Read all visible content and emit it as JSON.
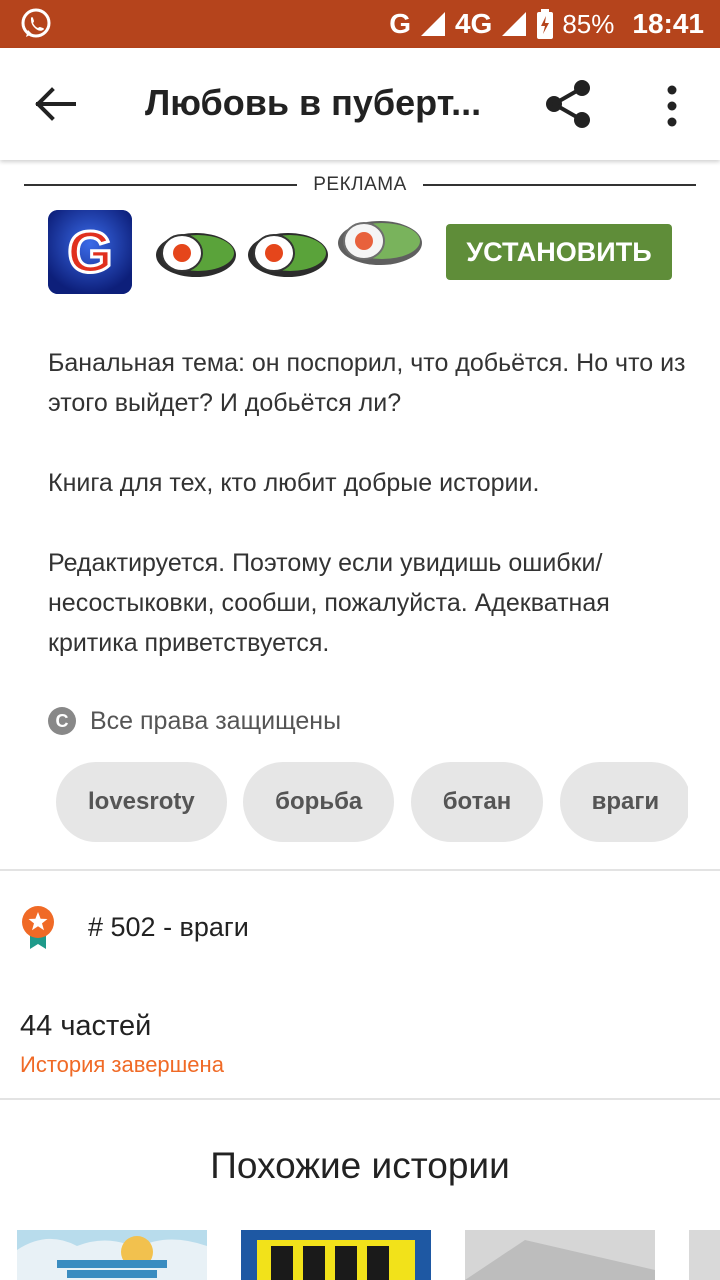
{
  "status_bar": {
    "carrier": "G",
    "network": "4G",
    "battery": "85%",
    "time": "18:41"
  },
  "appbar": {
    "title": "Любовь в пуберт...",
    "back_icon": "arrow-left-icon",
    "share_icon": "share-icon",
    "more_icon": "more-vertical-icon"
  },
  "ad": {
    "label": "РЕКЛАМА",
    "app_icon_letter": "G",
    "install_label": "УСТАНОВИТЬ",
    "colors": {
      "install_bg": "#5f8d39"
    }
  },
  "description": {
    "paragraphs": [
      "Банальная тема: он поспорил, что добьётся. Но что из этого выйдет? И добьётся ли?",
      "Книга для тех, кто любит добрые истории.",
      "Редактируется. Поэтому если увидишь ошибки/несостыковки, сообши, пожалуйста. Адекватная критика приветствуется."
    ]
  },
  "copyright": {
    "icon": "copyright-icon",
    "text": "Все права защищены"
  },
  "tags": [
    "lovesroty",
    "борьба",
    "ботан",
    "враги"
  ],
  "ranking": {
    "icon": "ribbon-star-icon",
    "text": "# 502 - враги"
  },
  "story": {
    "parts": "44 частей",
    "status": "История завершена",
    "status_color": "#f06a26"
  },
  "similar": {
    "heading": "Похожие истории"
  },
  "colors": {
    "status_bar": "#b5441c",
    "accent": "#f06a26"
  }
}
